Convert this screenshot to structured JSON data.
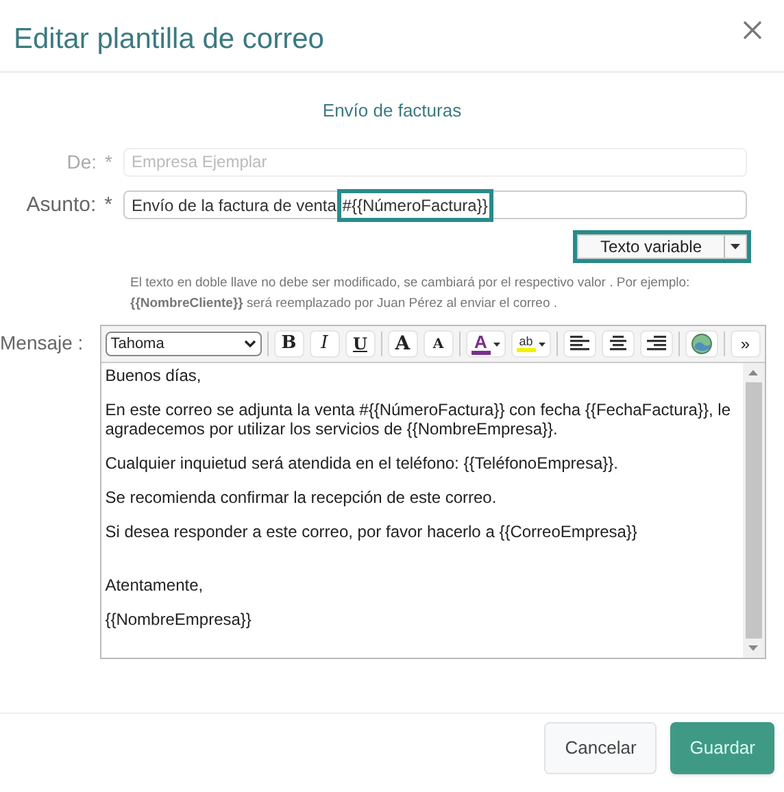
{
  "dialog": {
    "title": "Editar plantilla de correo",
    "subtitle": "Envío de facturas"
  },
  "from": {
    "label": "De:",
    "required_mark": "*",
    "value": "Empresa Ejemplar",
    "disabled": true
  },
  "subject": {
    "label": "Asunto:",
    "required_mark": "*",
    "value": "Envío de la factura de venta ",
    "variable": "#{{NúmeroFactura}}",
    "highlighted": true
  },
  "variable_button": {
    "label": "Texto variable",
    "highlighted": true
  },
  "note": "El texto en doble llave no debe ser modificado, se cambiará por el respectivo valor . Por ejemplo: **{{NombreCliente}}** será reemplazado por Juan Pérez al enviar el correo .",
  "message": {
    "label": "Mensaje :",
    "font": "Tahoma",
    "toolbar": [
      {
        "kind": "bold",
        "label": "B"
      },
      {
        "kind": "italic",
        "label": "I"
      },
      {
        "kind": "underline",
        "label": "U"
      },
      {
        "kind": "sep"
      },
      {
        "kind": "grow",
        "label": "A"
      },
      {
        "kind": "shrink",
        "label": "A"
      },
      {
        "kind": "sep"
      },
      {
        "kind": "fontcolor",
        "label": "A",
        "color": "#7b2e8e"
      },
      {
        "kind": "highlight",
        "label": "ab",
        "color": "#f2f200"
      },
      {
        "kind": "sep"
      },
      {
        "kind": "align-left"
      },
      {
        "kind": "align-center"
      },
      {
        "kind": "align-right"
      },
      {
        "kind": "sep"
      },
      {
        "kind": "image"
      },
      {
        "kind": "sep"
      },
      {
        "kind": "more",
        "label": "»"
      }
    ],
    "paragraphs": [
      "Buenos días,",
      "En este correo se adjunta la venta #{{NúmeroFactura}} con fecha {{FechaFactura}}, le agradecemos por utilizar los servicios de {{NombreEmpresa}}.",
      "Cualquier inquietud será atendida en el teléfono: {{TeléfonoEmpresa}}.",
      "Se recomienda confirmar la recepción de este correo.",
      "Si desea responder a este correo, por favor hacerlo a {{CorreoEmpresa}}",
      "Atentamente,",
      "{{NombreEmpresa}}"
    ]
  },
  "buttons": [
    {
      "kind": "secondary",
      "label": "Cancelar"
    },
    {
      "kind": "primary",
      "label": "Guardar"
    }
  ]
}
